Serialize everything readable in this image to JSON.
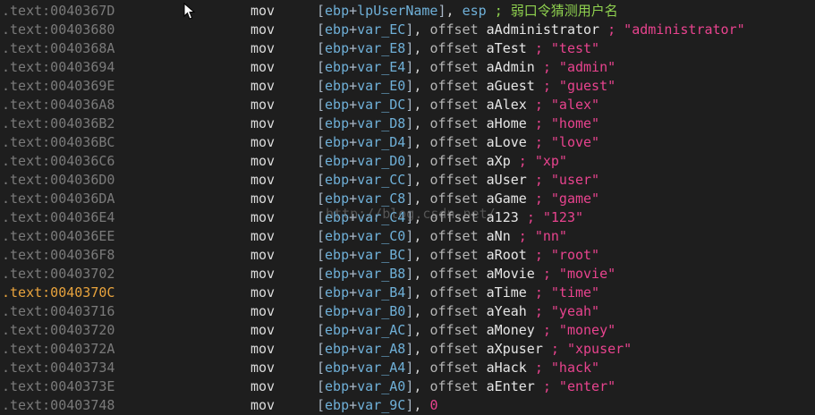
{
  "rows": [
    {
      "addr": ".text:0040367D",
      "mnem": "mov",
      "base": "ebp",
      "var": "lpUserName",
      "src_kind": "reg",
      "src": "esp",
      "comment": "; 弱口令猜测用户名",
      "cmt_cn": true
    },
    {
      "addr": ".text:00403680",
      "mnem": "mov",
      "base": "ebp",
      "var": "var_EC",
      "src_kind": "offset",
      "kw": "offset",
      "src": "aAdministrator",
      "comment": "; \"administrator\""
    },
    {
      "addr": ".text:0040368A",
      "mnem": "mov",
      "base": "ebp",
      "var": "var_E8",
      "src_kind": "offset",
      "kw": "offset",
      "src": "aTest",
      "comment": "; \"test\""
    },
    {
      "addr": ".text:00403694",
      "mnem": "mov",
      "base": "ebp",
      "var": "var_E4",
      "src_kind": "offset",
      "kw": "offset",
      "src": "aAdmin",
      "comment": "; \"admin\""
    },
    {
      "addr": ".text:0040369E",
      "mnem": "mov",
      "base": "ebp",
      "var": "var_E0",
      "src_kind": "offset",
      "kw": "offset",
      "src": "aGuest",
      "comment": "; \"guest\""
    },
    {
      "addr": ".text:004036A8",
      "mnem": "mov",
      "base": "ebp",
      "var": "var_DC",
      "src_kind": "offset",
      "kw": "offset",
      "src": "aAlex",
      "comment": "; \"alex\""
    },
    {
      "addr": ".text:004036B2",
      "mnem": "mov",
      "base": "ebp",
      "var": "var_D8",
      "src_kind": "offset",
      "kw": "offset",
      "src": "aHome",
      "comment": "; \"home\""
    },
    {
      "addr": ".text:004036BC",
      "mnem": "mov",
      "base": "ebp",
      "var": "var_D4",
      "src_kind": "offset",
      "kw": "offset",
      "src": "aLove",
      "comment": "; \"love\""
    },
    {
      "addr": ".text:004036C6",
      "mnem": "mov",
      "base": "ebp",
      "var": "var_D0",
      "src_kind": "offset",
      "kw": "offset",
      "src": "aXp",
      "comment": "; \"xp\""
    },
    {
      "addr": ".text:004036D0",
      "mnem": "mov",
      "base": "ebp",
      "var": "var_CC",
      "src_kind": "offset",
      "kw": "offset",
      "src": "aUser",
      "comment": "; \"user\""
    },
    {
      "addr": ".text:004036DA",
      "mnem": "mov",
      "base": "ebp",
      "var": "var_C8",
      "src_kind": "offset",
      "kw": "offset",
      "src": "aGame",
      "comment": "; \"game\""
    },
    {
      "addr": ".text:004036E4",
      "mnem": "mov",
      "base": "ebp",
      "var": "var_C4",
      "src_kind": "offset",
      "kw": "offset",
      "src": "a123",
      "comment": "; \"123\""
    },
    {
      "addr": ".text:004036EE",
      "mnem": "mov",
      "base": "ebp",
      "var": "var_C0",
      "src_kind": "offset",
      "kw": "offset",
      "src": "aNn",
      "comment": "; \"nn\""
    },
    {
      "addr": ".text:004036F8",
      "mnem": "mov",
      "base": "ebp",
      "var": "var_BC",
      "src_kind": "offset",
      "kw": "offset",
      "src": "aRoot",
      "comment": "; \"root\""
    },
    {
      "addr": ".text:00403702",
      "mnem": "mov",
      "base": "ebp",
      "var": "var_B8",
      "src_kind": "offset",
      "kw": "offset",
      "src": "aMovie",
      "comment": "; \"movie\""
    },
    {
      "addr": ".text:0040370C",
      "mnem": "mov",
      "base": "ebp",
      "var": "var_B4",
      "src_kind": "offset",
      "kw": "offset",
      "src": "aTime",
      "comment": "; \"time\"",
      "current": true
    },
    {
      "addr": ".text:00403716",
      "mnem": "mov",
      "base": "ebp",
      "var": "var_B0",
      "src_kind": "offset",
      "kw": "offset",
      "src": "aYeah",
      "comment": "; \"yeah\""
    },
    {
      "addr": ".text:00403720",
      "mnem": "mov",
      "base": "ebp",
      "var": "var_AC",
      "src_kind": "offset",
      "kw": "offset",
      "src": "aMoney",
      "comment": "; \"money\""
    },
    {
      "addr": ".text:0040372A",
      "mnem": "mov",
      "base": "ebp",
      "var": "var_A8",
      "src_kind": "offset",
      "kw": "offset",
      "src": "aXpuser",
      "comment": "; \"xpuser\""
    },
    {
      "addr": ".text:00403734",
      "mnem": "mov",
      "base": "ebp",
      "var": "var_A4",
      "src_kind": "offset",
      "kw": "offset",
      "src": "aHack",
      "comment": "; \"hack\""
    },
    {
      "addr": ".text:0040373E",
      "mnem": "mov",
      "base": "ebp",
      "var": "var_A0",
      "src_kind": "offset",
      "kw": "offset",
      "src": "aEnter",
      "comment": "; \"enter\""
    },
    {
      "addr": ".text:00403748",
      "mnem": "mov",
      "base": "ebp",
      "var": "var_9C",
      "src_kind": "imm",
      "src": "0",
      "comment": ""
    }
  ],
  "watermark": "http://blog.csdn.net/",
  "colors": {
    "background": "#1e1e1e",
    "address": "#7a7a7a",
    "address_current": "#e8a33d",
    "register": "#6fb0d8",
    "string_comment": "#e8438e",
    "comment_cn": "#8fd14f"
  },
  "icons": {
    "cursor": "mouse-pointer-icon"
  }
}
